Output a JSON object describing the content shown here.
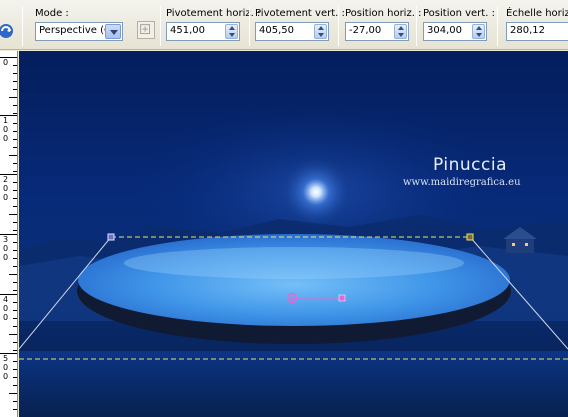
{
  "toolbar": {
    "mode": {
      "label": "Mode :",
      "value": "Perspective (Ct"
    },
    "pivot_h": {
      "label": "Pivotement horiz. :",
      "value": "451,00"
    },
    "pivot_v": {
      "label": "Pivotement vert. :",
      "value": "405,50"
    },
    "pos_h": {
      "label": "Position horiz. :",
      "value": "-27,00"
    },
    "pos_v": {
      "label": "Position vert. :",
      "value": "304,00"
    },
    "scale_h": {
      "label": "Échelle horizon",
      "value": "280,12"
    }
  },
  "ruler": {
    "labels": [
      {
        "id": "r0",
        "digits": [
          "0"
        ]
      },
      {
        "id": "r100",
        "digits": [
          "1",
          "0",
          "0"
        ]
      },
      {
        "id": "r200",
        "digits": [
          "2",
          "0",
          "0"
        ]
      },
      {
        "id": "r300",
        "digits": [
          "3",
          "0",
          "0"
        ]
      },
      {
        "id": "r400",
        "digits": [
          "4",
          "0",
          "0"
        ]
      },
      {
        "id": "r500",
        "digits": [
          "5",
          "0",
          "0"
        ]
      }
    ]
  },
  "canvas": {
    "signature_name": "Pinuccia",
    "signature_url": "www.maidiregrafica.eu"
  },
  "colors": {
    "background_top": "#041e5d",
    "disc_fill": "#4ea4ee",
    "guide_line": "#e8e36a",
    "handle": "#e26ad6"
  },
  "icons": [
    "transform-tool-icon",
    "spin-up-down-icon",
    "dropdown-arrow-icon",
    "aspect-toggle-icon",
    "pivot-handle-icon"
  ]
}
